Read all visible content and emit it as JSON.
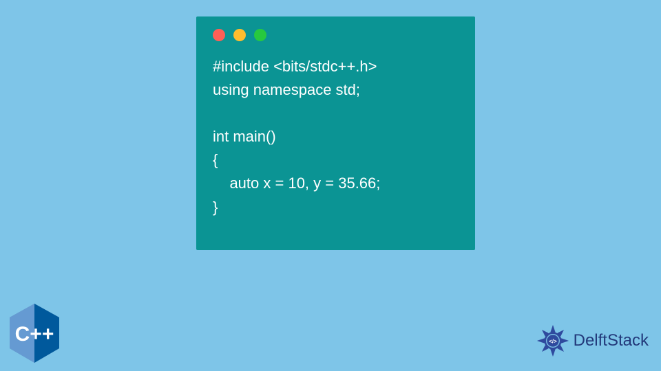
{
  "code": {
    "line1": "#include <bits/stdc++.h>",
    "line2": "using namespace std;",
    "line3": "",
    "line4": "int main()",
    "line5": "{",
    "line6": "    auto x = 10, y = 35.66;",
    "line7": "}"
  },
  "logo": {
    "text": "DelftStack"
  },
  "badge": {
    "label": "C++"
  },
  "colors": {
    "background": "#7ec5e8",
    "codeWindow": "#0b9494",
    "dotRed": "#ff5f56",
    "dotYellow": "#ffbd2e",
    "dotGreen": "#27c93f",
    "logoBlue": "#22397a",
    "cppBlue": "#5c8dbc"
  }
}
